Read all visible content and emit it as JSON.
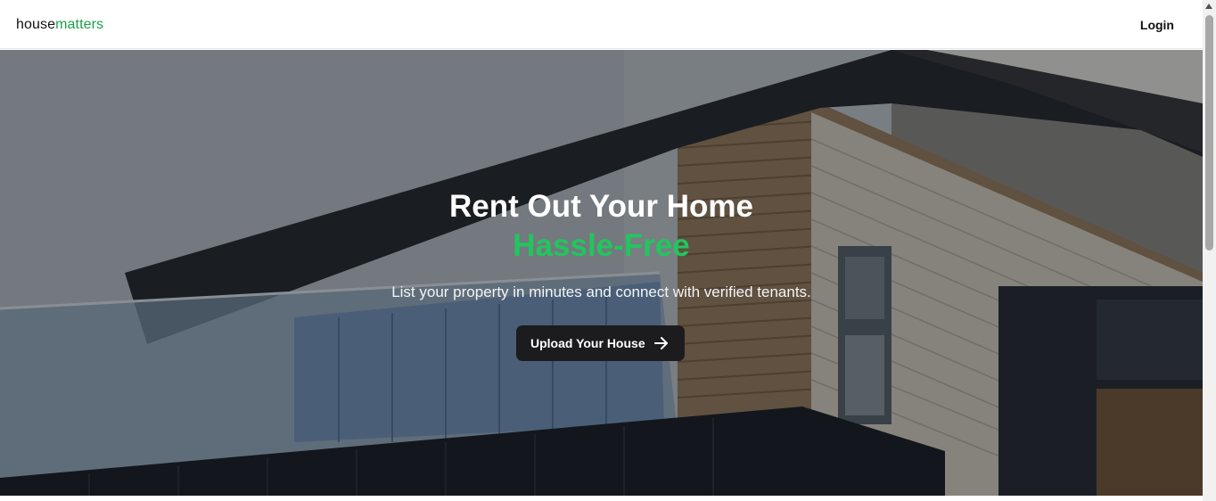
{
  "navbar": {
    "logo_part1": "house",
    "logo_part2": "matters",
    "login_label": "Login"
  },
  "hero": {
    "title_line1": "Rent Out Your Home",
    "title_line2": "Hassle-Free",
    "subtitle": "List your property in minutes and connect with verified tenants.",
    "cta_label": "Upload Your House",
    "cta_icon": "arrow-right-icon"
  },
  "colors": {
    "brand_accent": "#16a34a",
    "hero_accent": "#22c55e",
    "button_bg": "#1c1c1e"
  }
}
